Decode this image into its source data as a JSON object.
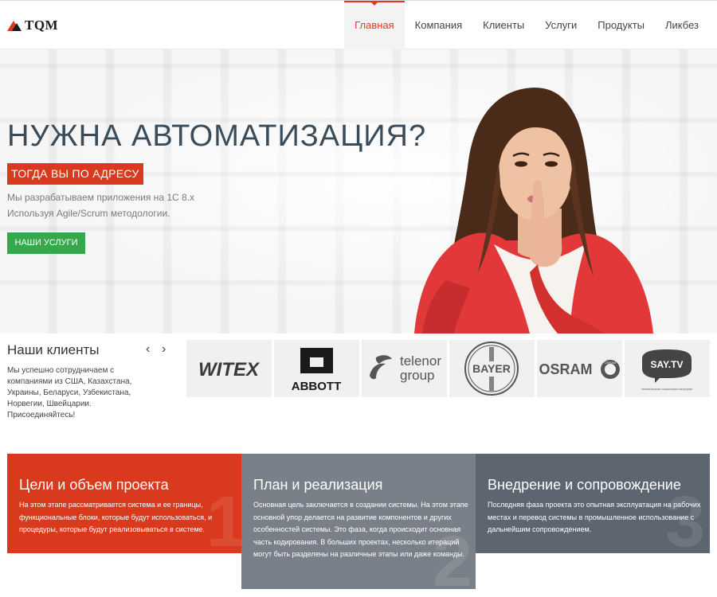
{
  "header": {
    "logo_text": "TQM",
    "nav": [
      {
        "label": "Главная",
        "active": true
      },
      {
        "label": "Компания"
      },
      {
        "label": "Клиенты"
      },
      {
        "label": "Услуги"
      },
      {
        "label": "Продукты"
      },
      {
        "label": "Ликбез"
      }
    ]
  },
  "hero": {
    "title": "НУЖНА АВТОМАТИЗАЦИЯ?",
    "tagline": "ТОГДА ВЫ ПО АДРЕСУ",
    "line1": "Мы разрабатываем приложения на 1С 8.х",
    "line2": "Используя Agile/Scrum методологии.",
    "button": "НАШИ УСЛУГИ"
  },
  "clients": {
    "title": "Наши клиенты",
    "prev": "‹",
    "next": "›",
    "text": "Мы успешно сотрудничаем с компаниями из США, Казахстана, Украины, Беларуси, Узбекистана, Норвегии, Швейцарии. Присоединяйтесь!",
    "logos": {
      "witex": "WITEX",
      "abbott": "ABBOTT",
      "telenor_1": "telenor",
      "telenor_2": "group",
      "bayer": "BAYER",
      "osram": "OSRAM",
      "osram_badge": "OSRAM",
      "saytv": "SAY.TV",
      "saytv_tagline": "телевизионная социальная платформа"
    }
  },
  "phases": [
    {
      "title": "Цели и объем проекта",
      "text": "На этом этапе рассматривается система и ее границы, функциональные блоки, которые будут использоваться, и процедуры, которые будут реализовываться в системе.",
      "num": "1"
    },
    {
      "title": "План и реализация",
      "text": "Основная цель заключается в создании системы. На этом этапе основной упор делается на развитие компонентов и других особенностей системы. Это фаза, когда происходит основная часть кодирования. В больших проектах, несколько итераций могут быть разделены на различные этапы или даже команды.",
      "num": "2"
    },
    {
      "title": "Внедрение и сопровождение",
      "text": "Последняя фаза проекта это опытная эксплуатация на рабочих местах и перевод системы в промышленное использование с дальнейшим сопровождением.",
      "num": "3"
    }
  ],
  "colors": {
    "accent": "#d9391c",
    "green": "#35a84c",
    "grey": "#7a8089",
    "dark_grey": "#5c6570"
  }
}
